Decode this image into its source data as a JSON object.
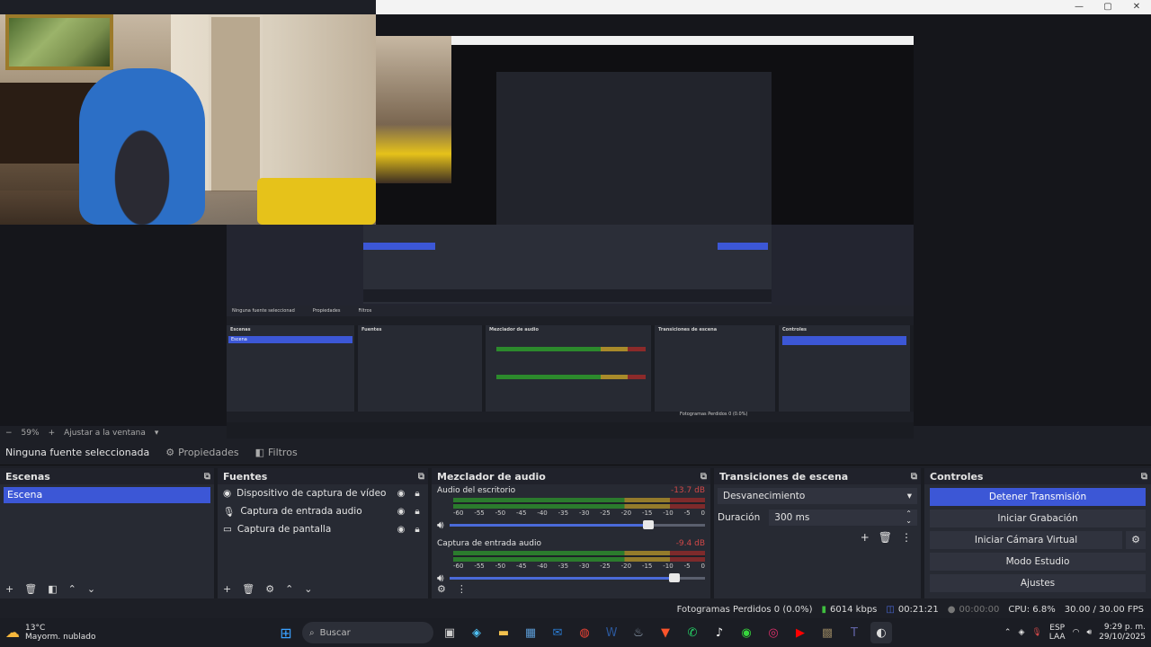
{
  "window": {
    "controls": [
      "—",
      "▢",
      "✕"
    ]
  },
  "inner_preview": {
    "context_label": "Ninguna fuente seleccionad",
    "properties": "Propiedades",
    "filters": "Filtros",
    "zoom": "59%",
    "fit": "Ajustar a la ventana",
    "scenes_title": "Escenas",
    "sources_title": "Fuentes",
    "mixer_title": "Mezclador de audio",
    "transitions_title": "Transiciones de escena",
    "controls_title": "Controles",
    "scene_item": "Escena",
    "status": "Fotogramas Perdidos 0 (0.0%)"
  },
  "zoombar": {
    "minus": "−",
    "zoom": "59%",
    "plus": "+",
    "fit_label": "Ajustar a la ventana"
  },
  "context": {
    "no_source": "Ninguna fuente seleccionada",
    "properties": "Propiedades",
    "filters": "Filtros"
  },
  "scenes": {
    "title": "Escenas",
    "items": [
      "Escena"
    ],
    "selected_index": 0
  },
  "sources": {
    "title": "Fuentes",
    "items": [
      {
        "label": "Dispositivo de captura de vídeo",
        "icon": "camera-icon"
      },
      {
        "label": "Captura de entrada audio",
        "icon": "microphone-icon"
      },
      {
        "label": "Captura de pantalla",
        "icon": "monitor-icon"
      }
    ]
  },
  "mixer": {
    "title": "Mezclador de audio",
    "channels": [
      {
        "name": "Audio del escritorio",
        "db": "-13.7 dB",
        "volume": 0.78
      },
      {
        "name": "Captura de entrada audio",
        "db": "-9.4 dB",
        "volume": 0.88
      }
    ],
    "ticks": [
      "-60",
      "-55",
      "-50",
      "-45",
      "-40",
      "-35",
      "-30",
      "-25",
      "-20",
      "-15",
      "-10",
      "-5",
      "0"
    ]
  },
  "transitions": {
    "title": "Transiciones de escena",
    "selected": "Desvanecimiento",
    "duration_label": "Duración",
    "duration_value": "300 ms"
  },
  "controls": {
    "title": "Controles",
    "stop_stream": "Detener Transmisión",
    "start_recording": "Iniciar Grabación",
    "start_virtual_cam": "Iniciar Cámara Virtual",
    "studio_mode": "Modo Estudio",
    "settings": "Ajustes"
  },
  "status": {
    "dropped": "Fotogramas Perdidos 0 (0.0%)",
    "bitrate": "6014 kbps",
    "stream_time": "00:21:21",
    "rec_time": "00:00:00",
    "cpu": "CPU: 6.8%",
    "fps": "30.00 / 30.00 FPS"
  },
  "taskbar": {
    "temp": "13°C",
    "weather": "Mayorm. nublado",
    "search_placeholder": "Buscar",
    "lang_top": "ESP",
    "lang_bottom": "LAA",
    "time": "9:29 p. m.",
    "date": "29/10/2025"
  },
  "colors": {
    "accent": "#3c57d6",
    "panel": "#272a33",
    "background": "#1d1f26"
  }
}
